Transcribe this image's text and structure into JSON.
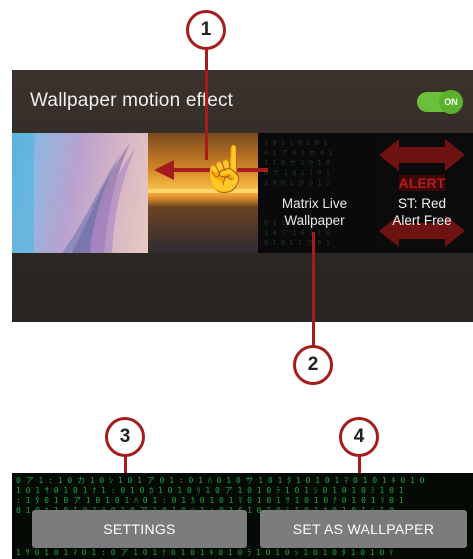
{
  "panel": {
    "title": "Wallpaper motion effect",
    "toggle_state": "ON"
  },
  "thumbnails": [
    {
      "id": "galaxy-wave",
      "caption": ""
    },
    {
      "id": "sunset",
      "caption": ""
    },
    {
      "id": "matrix",
      "caption_line1": "Matrix Live",
      "caption_line2": "Wallpaper"
    },
    {
      "id": "red-alert",
      "caption_line1": "ST: Red",
      "caption_line2": "Alert Free",
      "badge": "ALERT"
    }
  ],
  "callouts": [
    "1",
    "2",
    "3",
    "4"
  ],
  "buttons": {
    "settings": "SETTINGS",
    "set_wallpaper": "SET AS WALLPAPER"
  },
  "colors": {
    "callout": "#a61b1b",
    "toggle": "#6cbf3a",
    "panel_bg": "#2e2824",
    "button": "#7c7c7c",
    "matrix_green": "#22c34a"
  }
}
